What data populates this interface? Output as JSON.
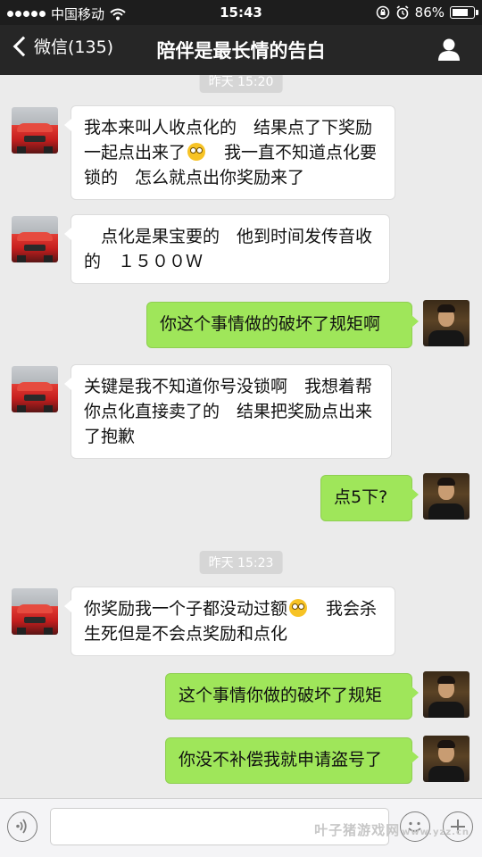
{
  "status_bar": {
    "carrier": "中国移动",
    "time": "15:43",
    "battery": "86%",
    "battery_level": 0.86,
    "icons": [
      "signal-dots-icon",
      "wifi-icon",
      "lock-rotation-icon",
      "alarm-icon",
      "battery-icon"
    ]
  },
  "nav": {
    "back_label": "微信(135)",
    "title": "陪伴是最长情的告白",
    "profile_icon": "person-icon"
  },
  "messages": [
    {
      "type": "timestamp",
      "text": "昨天 15:20"
    },
    {
      "type": "left",
      "avatar": "car-avatar",
      "text": "我本来叫人收点化的　结果点了下奖励一起点出来了{e}　我一直不知道点化要锁的　怎么就点出你奖励来了",
      "emoji": "flushed-emoji"
    },
    {
      "type": "left",
      "avatar": "car-avatar",
      "text": "　点化是果宝要的　他到时间发传音收的　１５００Ｗ"
    },
    {
      "type": "right",
      "avatar": "man-avatar",
      "text": "你这个事情做的破坏了规矩啊"
    },
    {
      "type": "left",
      "avatar": "car-avatar",
      "text": "关键是我不知道你号没锁啊　我想着帮你点化直接卖了的　结果把奖励点出来了抱歉"
    },
    {
      "type": "right",
      "avatar": "man-avatar",
      "text": "点5下?"
    },
    {
      "type": "timestamp",
      "text": "昨天 15:23"
    },
    {
      "type": "left",
      "avatar": "car-avatar",
      "text": "你奖励我一个子都没动过额{e}　我会杀生死但是不会点奖励和点化",
      "emoji": "flushed-emoji"
    },
    {
      "type": "right",
      "avatar": "man-avatar",
      "text": "这个事情你做的破坏了规矩"
    },
    {
      "type": "right",
      "avatar": "man-avatar",
      "text": "你没不补偿我就申请盗号了"
    }
  ],
  "input_bar": {
    "placeholder": "",
    "watermark": "叶子猪游戏网",
    "watermark_sub": "www.yzz.cn"
  },
  "colors": {
    "sent_bubble": "#9fe65a",
    "received_bubble": "#ffffff",
    "nav_bg": "#262626",
    "chat_bg": "#ebebeb"
  }
}
